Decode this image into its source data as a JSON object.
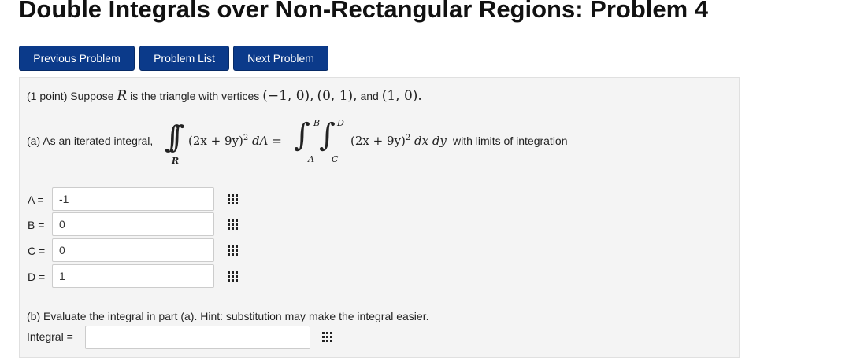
{
  "page": {
    "title": "Double Integrals over Non-Rectangular Regions: Problem 4"
  },
  "nav": {
    "previous_label": "Previous Problem",
    "list_label": "Problem List",
    "next_label": "Next Problem"
  },
  "problem": {
    "points": "(1 point)",
    "intro": "Suppose",
    "R": "R",
    "is_triangle": "is the triangle with vertices",
    "v1": "(−1, 0),",
    "v2": "(0, 1),",
    "and": "and",
    "v3": "(1, 0).",
    "part_a_intro": "(a) As an iterated integral,",
    "integrand": "(2x + 9y)",
    "dA": "dA =",
    "dxdy": "dx dy",
    "limits_text": "with limits of integration",
    "sub_R": "R",
    "lim_A": "A",
    "lim_B": "B",
    "lim_C": "C",
    "lim_D": "D",
    "exponent": "2",
    "part_b": "(b) Evaluate the integral in part (a). Hint: substitution may make the integral easier."
  },
  "answers": {
    "A": {
      "label": "A =",
      "value": "-1"
    },
    "B": {
      "label": "B =",
      "value": "0"
    },
    "C": {
      "label": "C =",
      "value": "0"
    },
    "D": {
      "label": "D =",
      "value": "1"
    },
    "integral": {
      "label": "Integral =",
      "value": ""
    }
  },
  "icons": {
    "equation_editor": "equation-editor-icon"
  }
}
